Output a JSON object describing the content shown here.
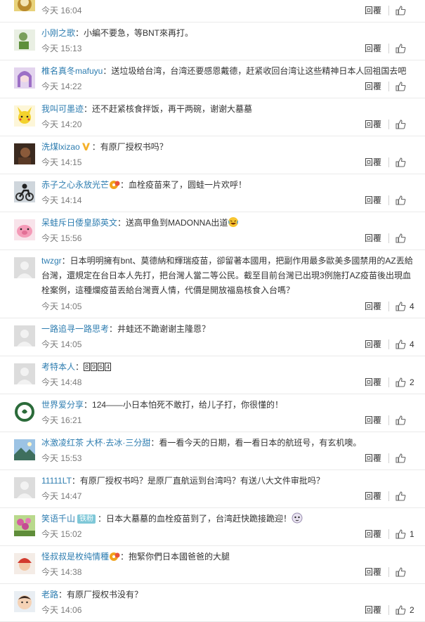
{
  "reply_label": "回覆",
  "colors": {
    "username": "#2e7db0",
    "time": "#7b7b7b",
    "divider": "#eaeaea"
  },
  "comments": [
    {
      "username": "",
      "text": "",
      "time": "今天 16:04",
      "likes": "",
      "avatar": "yellow-cartoon-avatar"
    },
    {
      "username": "小刚之歌",
      "text": "：小編不要急，等BNT來再打。",
      "time": "今天 15:13",
      "likes": "",
      "avatar": "green-cartoon-avatar"
    },
    {
      "username": "椎名真冬mafuyu",
      "text": "：送垃圾给台湾，台湾还要感恩戴德，赶紧收回台湾让这些精神日本人回祖国去吧",
      "time": "今天 14:22",
      "likes": "",
      "avatar": "anime-girl-avatar"
    },
    {
      "username": "我叫可墨迹",
      "text": "：还不赶紧核食拌饭，再干两碗，谢谢大墓墓",
      "time": "今天 14:20",
      "likes": "",
      "avatar": "pikachu-avatar"
    },
    {
      "username": "洗煤lxizao",
      "badge": "V",
      "text": "：有原厂授权书吗？",
      "time": "今天 14:15",
      "likes": "",
      "avatar": "dark-photo-avatar"
    },
    {
      "username": "赤子之心永放光芒",
      "text": "：血栓疫苗来了，圆蛙一片欢呼！",
      "time": "今天 14:14",
      "likes": "",
      "avatar": "motorcycle-avatar"
    },
    {
      "username": "呆蛙斥日倭皇舔英文",
      "text": "：送高甲鱼到MADONNA出道",
      "time": "今天 15:56",
      "likes": "",
      "avatar": "pink-pig-avatar"
    },
    {
      "username": "twzgr",
      "text": "：日本明明擁有bnt、莫德納和輝瑞疫苗，卻留著本國用，把副作用最多歐美多國禁用的AZ丟給台灣，還規定在台日本人先打，把台灣人當二等公民。截至目前台灣已出現3例施打AZ疫苗後出現血栓案例，這種爛疫苗丟給台灣賣人情，代價是開放福島核食入台嗎？",
      "time": "今天 14:05",
      "likes": "4",
      "avatar": "default-avatar"
    },
    {
      "username": "一路追寻一路思考",
      "text": "：井蛙还不跪谢谢主隆恩？",
      "time": "今天 14:05",
      "likes": "4",
      "avatar": "default-avatar"
    },
    {
      "username": "考特本人",
      "text": "：",
      "numbers": [
        "8",
        "9",
        "6",
        "4"
      ],
      "time": "今天 14:48",
      "likes": "2",
      "avatar": "default-avatar"
    },
    {
      "username": "世界爱分享",
      "text": "：124——小日本怕死不敢打，给儿子打，你很懂的！",
      "time": "今天 16:21",
      "likes": "",
      "avatar": "green-ring-avatar"
    },
    {
      "username": "冰激凌红茶 大杯·去冰·三分甜",
      "text": "：看一看今天的日期，看一看日本的航班号，有玄机噢。",
      "time": "今天 15:53",
      "likes": "",
      "avatar": "landscape-avatar"
    },
    {
      "username": "11111LT",
      "text": "：有原厂授权书吗？是原厂直航运到台湾吗？有送八大文件审批吗？",
      "time": "今天 14:47",
      "likes": "",
      "avatar": "default-avatar"
    },
    {
      "username": "笑语千山",
      "tag": "铁粉",
      "text": "：日本大墓墓的血栓疫苗到了，台湾赶快跪接跪迎！",
      "time": "今天 15:02",
      "likes": "1",
      "avatar": "flower-avatar"
    },
    {
      "username": "怪叔叔是枚纯情種",
      "text": "：抱緊你們日本國爸爸的大腿",
      "time": "今天 14:38",
      "likes": "",
      "avatar": "red-hat-avatar"
    },
    {
      "username": "老路",
      "text": "：有原厂授权书没有？",
      "time": "今天 14:06",
      "likes": "2",
      "avatar": "baby-avatar"
    }
  ]
}
